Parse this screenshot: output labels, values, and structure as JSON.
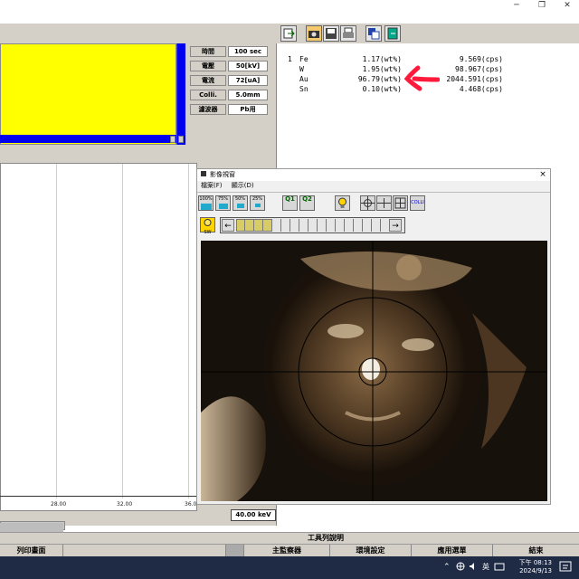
{
  "window": {
    "min_glyph": "─",
    "restore_glyph": "❐",
    "close_glyph": "✕"
  },
  "params": [
    {
      "label": "時間",
      "value": "100 sec"
    },
    {
      "label": "電壓",
      "value": "50[kV]"
    },
    {
      "label": "電流",
      "value": "72[uA]"
    },
    {
      "label": "Colli.",
      "value": "5.0mm"
    },
    {
      "label": "濾波器",
      "value": "Pb用"
    }
  ],
  "results": {
    "index": "1",
    "rows": [
      {
        "element": "Fe",
        "wt": "1.17(wt%)",
        "cps": "9.569(cps)"
      },
      {
        "element": "W",
        "wt": "1.95(wt%)",
        "cps": "98.967(cps)"
      },
      {
        "element": "Au",
        "wt": "96.79(wt%)",
        "cps": "2044.591(cps)"
      },
      {
        "element": "Sn",
        "wt": "0.10(wt%)",
        "cps": "4.468(cps)"
      }
    ],
    "annotation_color": "#ff1a3c"
  },
  "plot": {
    "x_ticks": [
      "28.00",
      "32.00",
      "36.0"
    ],
    "energy_max": "40.00 keV"
  },
  "image_window": {
    "title": "影像視窗",
    "close_glyph": "×",
    "menu": [
      "檔案(F)",
      "顯示(D)"
    ],
    "zoom_buttons": [
      "100%",
      "75%",
      "50%",
      "25%"
    ],
    "q_buttons": [
      "Q1",
      "Q2"
    ],
    "coll_label": "COLLI",
    "sw_label": "SW",
    "left_arrow": "←",
    "right_arrow": "→"
  },
  "bottom": {
    "toolbar_help": "工具列說明",
    "print_screen": "列印畫面",
    "main_view": "主監察器",
    "env_settings": "環境設定",
    "app_select": "應用選單",
    "exit": "結束"
  },
  "taskbar": {
    "lang": "英",
    "time": "下午 08:13",
    "date": "2024/9/13"
  },
  "colors": {
    "spectrum_fill": "#ffff00",
    "spectrum_base": "#0000ee"
  }
}
